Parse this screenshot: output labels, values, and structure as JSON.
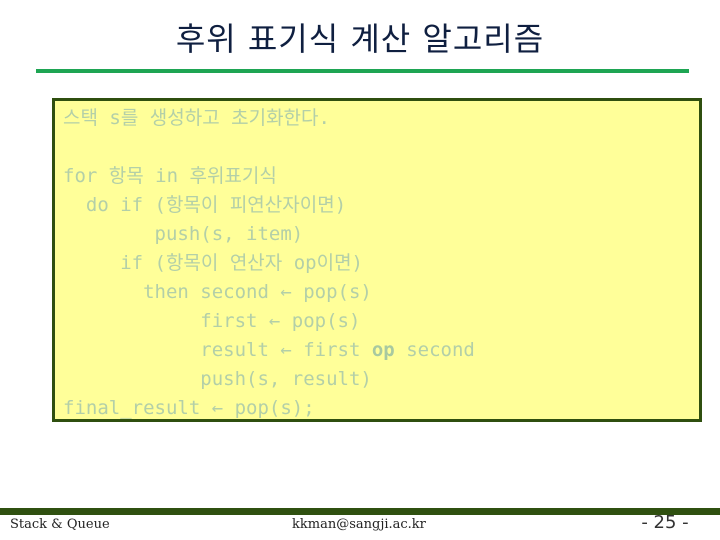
{
  "slide": {
    "title": "후위 표기식 계산 알고리즘",
    "colors": {
      "title_text": "#0f1f40",
      "title_rule": "#1ea553",
      "box_background": "#ffff99",
      "box_border": "#2f4f0f",
      "code_text": "#b3cfa8",
      "footer_rule": "#2f5010"
    }
  },
  "code": {
    "lines": [
      {
        "text": "스택 s를 생성하고 초기화한다."
      },
      {
        "text": ""
      },
      {
        "text": "for 항목 in 후위표기식"
      },
      {
        "text": "  do if (항목이 피연산자이면)"
      },
      {
        "text": "        push(s, item)"
      },
      {
        "text": "     if (항목이 연산자 op이면)"
      },
      {
        "text": "       then second ← pop(s)"
      },
      {
        "text": "            first ← pop(s)"
      },
      {
        "pre": "            result ← first ",
        "bold": "op",
        "post": " second"
      },
      {
        "text": "            push(s, result)"
      },
      {
        "text": "final_result ← pop(s);"
      }
    ]
  },
  "footer": {
    "left": "Stack & Queue",
    "center": "kkman@sangji.ac.kr",
    "page": "- 25 -"
  }
}
